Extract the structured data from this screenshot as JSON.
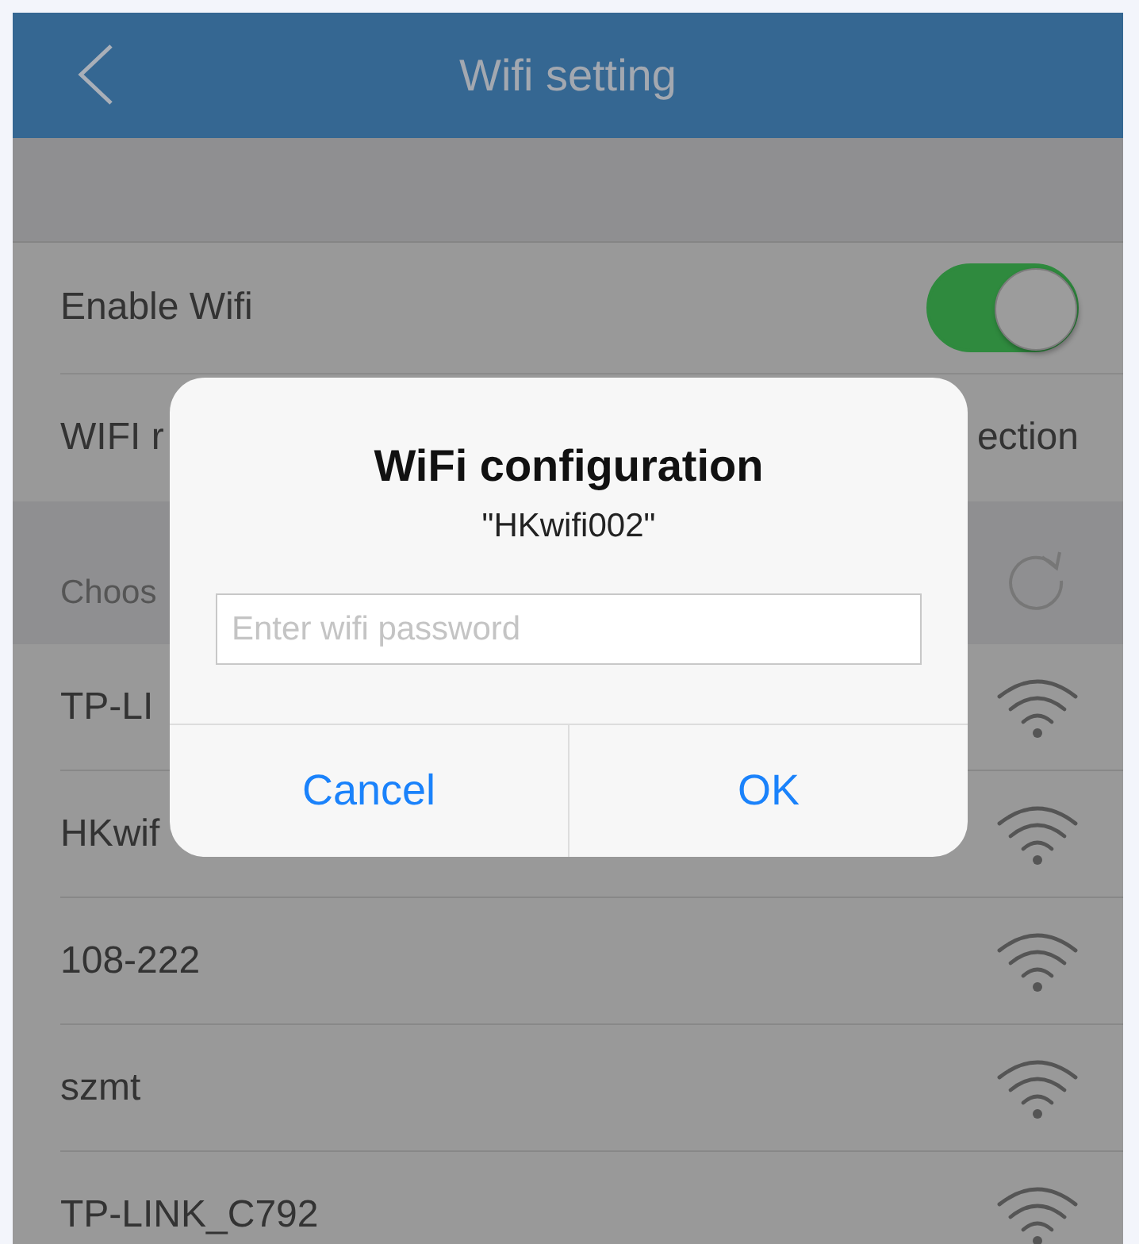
{
  "header": {
    "title": "Wifi setting"
  },
  "settings": [
    {
      "kind": "toggle",
      "label": "Enable Wifi",
      "on": true
    },
    {
      "kind": "value",
      "label": "WIFI r",
      "value": "ection"
    }
  ],
  "section": {
    "label": "Choos"
  },
  "networks": [
    {
      "name": "TP-LI"
    },
    {
      "name": "HKwif"
    },
    {
      "name": "108-222"
    },
    {
      "name": "szmt"
    },
    {
      "name": "TP-LINK_C792"
    }
  ],
  "dialog": {
    "title": "WiFi configuration",
    "subtitle": "\"HKwifi002\"",
    "password": {
      "placeholder": "Enter wifi password"
    },
    "buttons": [
      {
        "label": "Cancel"
      },
      {
        "label": "OK"
      }
    ]
  }
}
